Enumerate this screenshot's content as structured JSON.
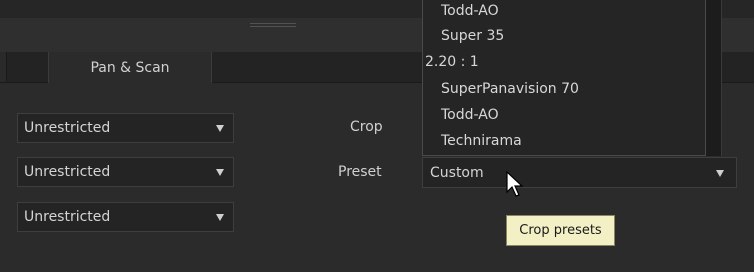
{
  "tab": {
    "label": "Pan & Scan"
  },
  "combos": [
    {
      "value": "Unrestricted"
    },
    {
      "value": "Unrestricted"
    },
    {
      "value": "Unrestricted"
    }
  ],
  "crop": {
    "label": "Crop"
  },
  "preset": {
    "label": "Preset",
    "value": "Custom"
  },
  "preset_list": {
    "items": [
      "Todd-AO",
      "Super 35",
      "2.20 : 1",
      "SuperPanavision 70",
      "Todd-AO",
      "Technirama"
    ]
  },
  "tooltip": {
    "text": "Crop presets"
  },
  "icons": {
    "dropdown": "chevron-down-icon",
    "cursor": "mouse-pointer-icon"
  }
}
